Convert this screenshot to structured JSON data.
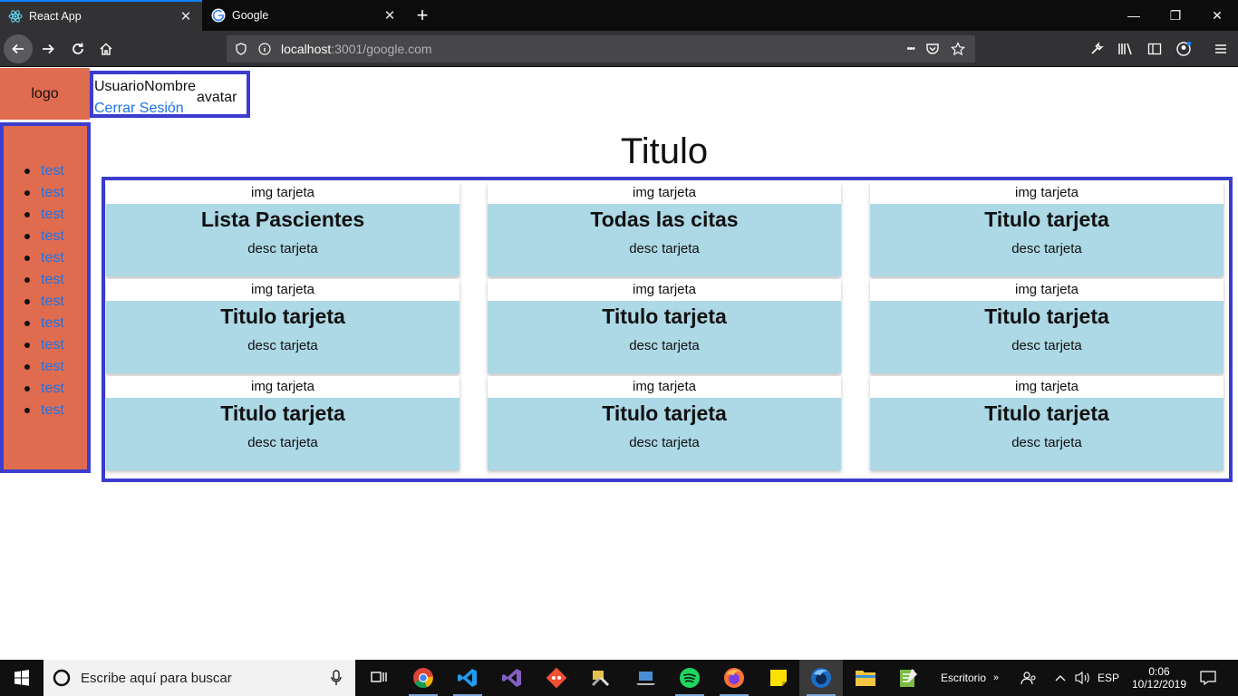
{
  "browser": {
    "tabs": [
      {
        "title": "React App",
        "icon": "react-icon"
      },
      {
        "title": "Google",
        "icon": "google-icon"
      }
    ],
    "url_host": "localhost",
    "url_rest": ":3001/google.com",
    "window_controls": {
      "minimize": "—",
      "restore": "❐",
      "close": "✕"
    },
    "tab_close_glyph": "✕",
    "new_tab_glyph": "+",
    "more_glyph": "•••"
  },
  "header": {
    "logo_text": "logo",
    "username": "UsuarioNombre",
    "avatar_text": "avatar",
    "logout_label": "Cerrar Sesión"
  },
  "sidebar": {
    "items": [
      {
        "label": "test"
      },
      {
        "label": "test"
      },
      {
        "label": "test"
      },
      {
        "label": "test"
      },
      {
        "label": "test"
      },
      {
        "label": "test"
      },
      {
        "label": "test"
      },
      {
        "label": "test"
      },
      {
        "label": "test"
      },
      {
        "label": "test"
      },
      {
        "label": "test"
      },
      {
        "label": "test"
      }
    ]
  },
  "main": {
    "title": "Titulo",
    "cards": [
      {
        "img": "img tarjeta",
        "title": "Lista Pascientes",
        "desc": "desc tarjeta"
      },
      {
        "img": "img tarjeta",
        "title": "Todas las citas",
        "desc": "desc tarjeta"
      },
      {
        "img": "img tarjeta",
        "title": "Titulo tarjeta",
        "desc": "desc tarjeta"
      },
      {
        "img": "img tarjeta",
        "title": "Titulo tarjeta",
        "desc": "desc tarjeta"
      },
      {
        "img": "img tarjeta",
        "title": "Titulo tarjeta",
        "desc": "desc tarjeta"
      },
      {
        "img": "img tarjeta",
        "title": "Titulo tarjeta",
        "desc": "desc tarjeta"
      },
      {
        "img": "img tarjeta",
        "title": "Titulo tarjeta",
        "desc": "desc tarjeta"
      },
      {
        "img": "img tarjeta",
        "title": "Titulo tarjeta",
        "desc": "desc tarjeta"
      },
      {
        "img": "img tarjeta",
        "title": "Titulo tarjeta",
        "desc": "desc tarjeta"
      }
    ]
  },
  "taskbar": {
    "search_placeholder": "Escribe aquí para buscar",
    "apps": [
      "task-view-icon",
      "chrome-icon",
      "vscode-icon",
      "visual-studio-icon",
      "git-icon",
      "tools-icon",
      "laptop-icon",
      "spotify-icon",
      "firefox-icon",
      "sticky-notes-icon",
      "firefox-developer-icon",
      "file-explorer-icon",
      "notepad-icon"
    ],
    "desktop_label": "Escritorio",
    "language": "ESP",
    "time": "0:06",
    "date": "10/12/2019"
  },
  "colors": {
    "accent_border": "#3c3ccf",
    "sidebar_bg": "#e06c50",
    "card_bg": "#add8e6",
    "link": "#1a73e8"
  }
}
